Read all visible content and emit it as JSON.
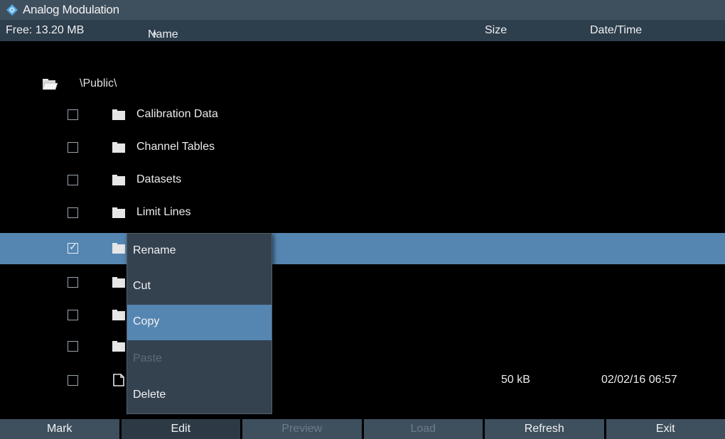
{
  "window": {
    "title": "Analog Modulation"
  },
  "header": {
    "free": "Free: 13.20 MB",
    "name": "Name",
    "sort_indicator": "▲",
    "size": "Size",
    "datetime": "Date/Time"
  },
  "path": "\\Public\\",
  "rows": [
    {
      "name": "Calibration Data",
      "type": "folder",
      "checked": false,
      "size": "",
      "date": ""
    },
    {
      "name": "Channel Tables",
      "type": "folder",
      "checked": false,
      "size": "",
      "date": ""
    },
    {
      "name": "Datasets",
      "type": "folder",
      "checked": false,
      "size": "",
      "date": ""
    },
    {
      "name": "Limit Lines",
      "type": "folder",
      "checked": false,
      "size": "",
      "date": ""
    },
    {
      "name": "",
      "type": "folder",
      "checked": true,
      "selected": true,
      "size": "",
      "date": ""
    },
    {
      "name": "",
      "type": "folder",
      "checked": false,
      "size": "",
      "date": ""
    },
    {
      "name": "",
      "type": "folder",
      "checked": false,
      "size": "",
      "date": ""
    },
    {
      "name": "",
      "type": "folder",
      "checked": false,
      "size": "",
      "date": ""
    },
    {
      "name": "",
      "type": "file",
      "checked": false,
      "size": "50 kB",
      "date": "02/02/16 06:57"
    }
  ],
  "context_menu": {
    "items": [
      {
        "label": "Rename",
        "state": "normal"
      },
      {
        "label": "Cut",
        "state": "normal"
      },
      {
        "label": "Copy",
        "state": "active"
      },
      {
        "label": "Paste",
        "state": "disabled"
      },
      {
        "label": "Delete",
        "state": "normal"
      }
    ]
  },
  "softkeys": [
    {
      "label": "Mark",
      "state": "normal"
    },
    {
      "label": "Edit",
      "state": "active"
    },
    {
      "label": "Preview",
      "state": "disabled"
    },
    {
      "label": "Load",
      "state": "disabled"
    },
    {
      "label": "Refresh",
      "state": "normal"
    },
    {
      "label": "Exit",
      "state": "normal"
    }
  ],
  "colors": {
    "accent": "#5586b2",
    "bar": "#3e4f5e",
    "header": "#2d3e4d",
    "background": "#000000"
  },
  "icons": {
    "logo": "diamond-logo-icon",
    "path": "open-folder-icon",
    "folder": "folder-icon",
    "file": "file-icon",
    "check": "checkmark-icon"
  }
}
